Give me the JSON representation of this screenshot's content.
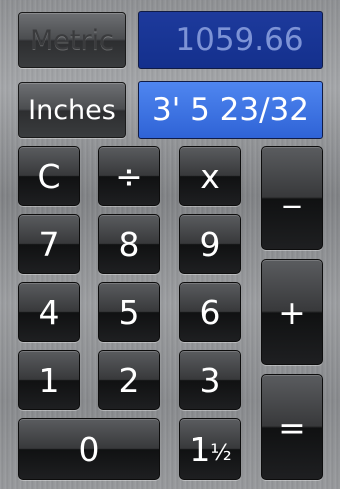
{
  "modes": {
    "metric_label": "Metric",
    "inches_label": "Inches"
  },
  "displays": {
    "metric_value": "1059.66",
    "inches_value": "3' 5 23/32"
  },
  "keys": {
    "clear": "C",
    "divide": "÷",
    "multiply": "x",
    "minus": "_",
    "plus": "+",
    "equals": "=",
    "seven": "7",
    "eight": "8",
    "nine": "9",
    "four": "4",
    "five": "5",
    "six": "6",
    "one": "1",
    "two": "2",
    "three": "3",
    "zero": "0",
    "fraction_whole": "1",
    "fraction_part": "½"
  },
  "colors": {
    "metric_display_bg": "#14308d",
    "inches_display_bg": "#3b70e0",
    "key_dark": "#1e1f21"
  }
}
